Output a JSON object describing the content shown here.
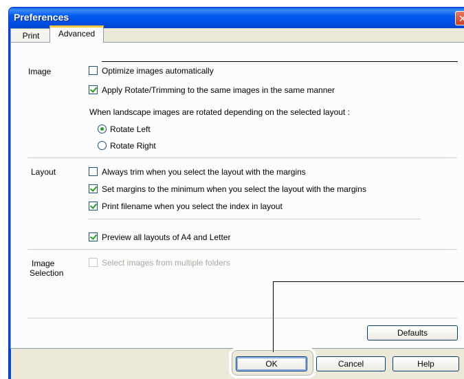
{
  "window": {
    "title": "Preferences",
    "close_icon": "close-icon",
    "accent": "#0054e3"
  },
  "tabs": [
    {
      "label": "Print",
      "active": false
    },
    {
      "label": "Advanced",
      "active": true
    }
  ],
  "sections": {
    "image": {
      "label": "Image",
      "optimize": {
        "label": "Optimize images automatically",
        "checked": false
      },
      "apply_rotate": {
        "label": "Apply Rotate/Trimming to the same images in the same manner",
        "checked": true
      },
      "rotation_note": "When landscape images are rotated depending on the selected layout :",
      "rotate_left": {
        "label": "Rotate Left",
        "selected": true
      },
      "rotate_right": {
        "label": "Rotate Right",
        "selected": false
      }
    },
    "layout": {
      "label": "Layout",
      "always_trim": {
        "label": "Always trim when you select the layout with the margins",
        "checked": false
      },
      "set_margins": {
        "label": "Set margins to the minimum when you select the layout with the margins",
        "checked": true
      },
      "print_filename": {
        "label": "Print filename when you select the index in layout",
        "checked": true
      },
      "preview_layouts": {
        "label": "Preview all layouts of A4 and Letter",
        "checked": true
      }
    },
    "image_selection": {
      "label_line1": "Image",
      "label_line2": "Selection",
      "multiple_folders": {
        "label": "Select images from multiple folders",
        "checked": false,
        "disabled": true
      }
    }
  },
  "buttons": {
    "defaults": "Defaults",
    "ok": "OK",
    "cancel": "Cancel",
    "help": "Help"
  }
}
